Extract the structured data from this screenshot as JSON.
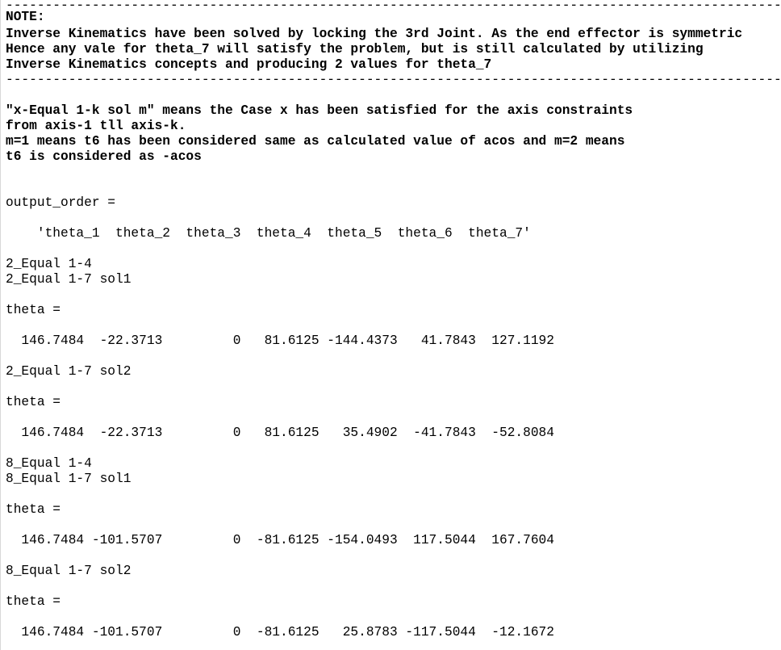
{
  "console": {
    "lines": [
      "----------------------------------------------------------------------------------------------------------",
      "NOTE:",
      "Inverse Kinematics have been solved by locking the 3rd Joint. As the end effector is symmetric",
      "Hence any vale for theta_7 will satisfy the problem, but is still calculated by utilizing",
      "Inverse Kinematics concepts and producing 2 values for theta_7",
      "----------------------------------------------------------------------------------------------------------",
      "\"x-Equal 1-k sol m\" means the Case x has been satisfied for the axis constraints",
      "from axis-1 tll axis-k.",
      "m=1 means t6 has been considered same as calculated value of acos and m=2 means",
      "t6 is considered as -acos",
      "output_order =",
      "    'theta_1  theta_2  theta_3  theta_4  theta_5  theta_6  theta_7'",
      "2_Equal 1-4",
      "2_Equal 1-7 sol1",
      "theta =",
      "  146.7484  -22.3713         0   81.6125 -144.4373   41.7843  127.1192",
      "2_Equal 1-7 sol2",
      "theta =",
      "  146.7484  -22.3713         0   81.6125   35.4902  -41.7843  -52.8084",
      "8_Equal 1-4",
      "8_Equal 1-7 sol1",
      "theta =",
      "  146.7484 -101.5707         0  -81.6125 -154.0493  117.5044  167.7604",
      "8_Equal 1-7 sol2",
      "theta =",
      "  146.7484 -101.5707         0  -81.6125   25.8783 -117.5044  -12.1672"
    ]
  }
}
